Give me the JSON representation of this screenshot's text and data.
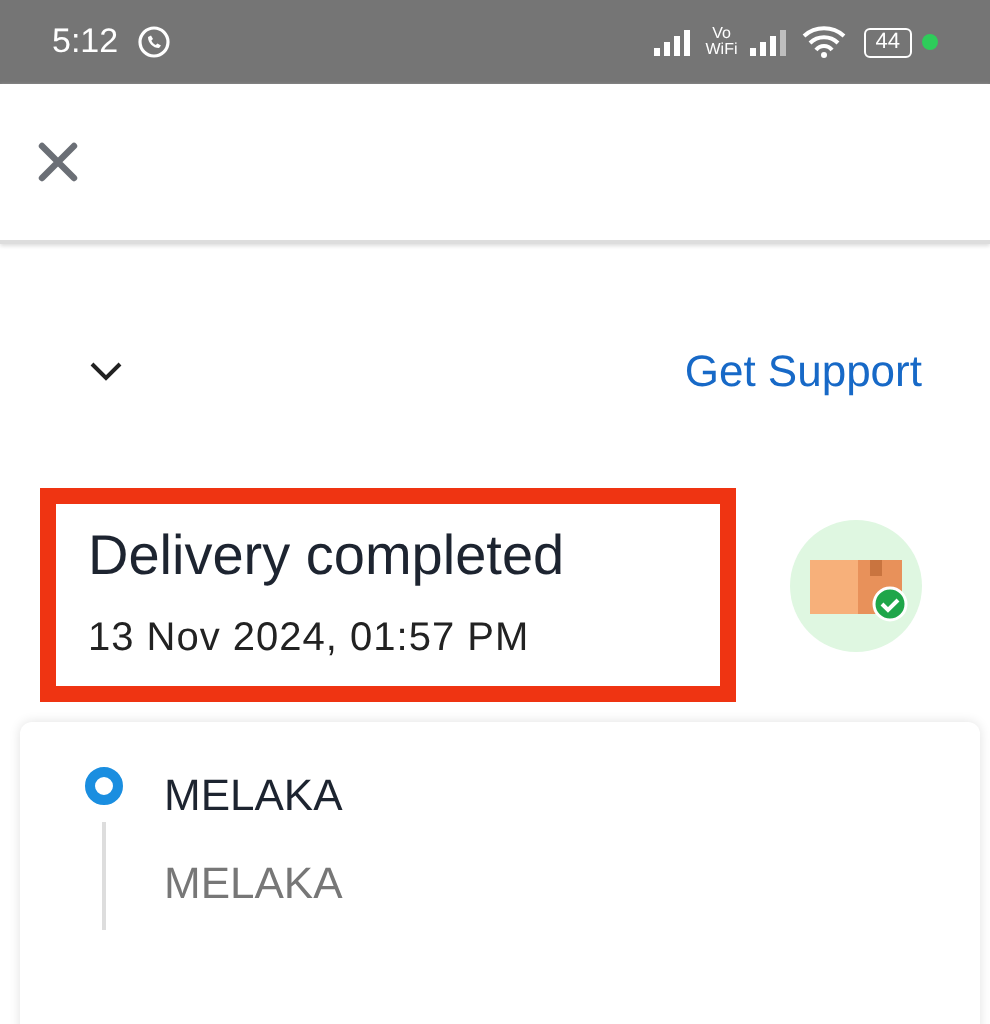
{
  "status_bar": {
    "time": "5:12",
    "network_label": "Vo WiFi",
    "battery": "44"
  },
  "support_link": "Get Support",
  "delivery": {
    "title": "Delivery completed",
    "timestamp": "13 Nov 2024, 01:57 PM",
    "highlighted": true
  },
  "tracking": [
    {
      "location": "MELAKA",
      "detail": "MELAKA",
      "current": true
    }
  ]
}
